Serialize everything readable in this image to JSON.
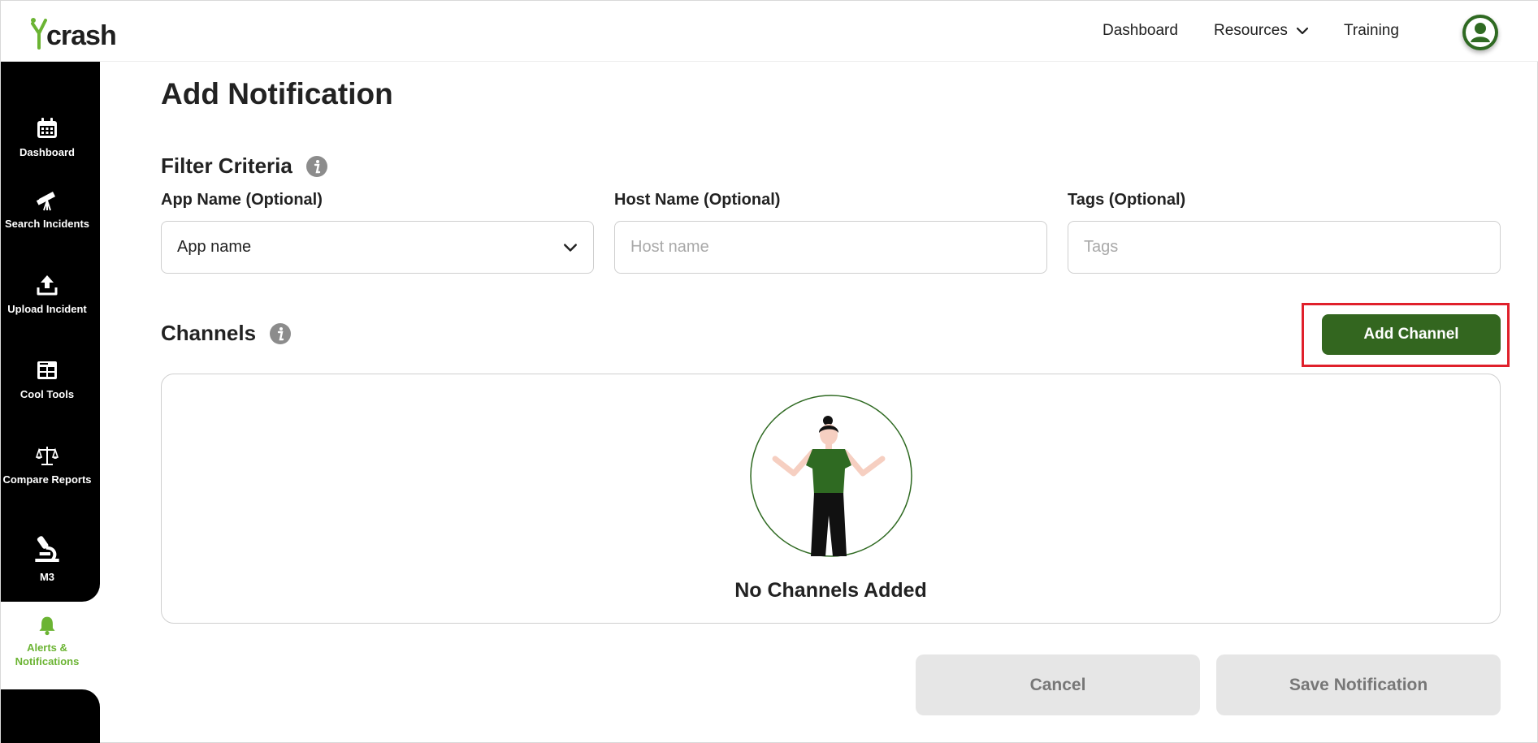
{
  "brand": {
    "name": "crash",
    "accent": "#33661f",
    "logo_green": "#6bb433"
  },
  "topnav": {
    "dashboard": "Dashboard",
    "resources": "Resources",
    "training": "Training",
    "avatar_icon": "user-circle-icon"
  },
  "sidebar": {
    "items": [
      {
        "label": "Dashboard",
        "icon": "calendar-icon"
      },
      {
        "label": "Search Incidents",
        "icon": "telescope-icon"
      },
      {
        "label": "Upload Incident",
        "icon": "upload-icon"
      },
      {
        "label": "Cool Tools",
        "icon": "grid-window-icon"
      },
      {
        "label": "Compare Reports",
        "icon": "scale-icon"
      },
      {
        "label": "M3",
        "icon": "microscope-icon"
      },
      {
        "label": "Alerts & Notifications",
        "icon": "bell-icon",
        "active": true
      }
    ]
  },
  "page": {
    "title": "Add Notification",
    "filter_title": "Filter Criteria",
    "app_name_label": "App Name (Optional)",
    "app_name_value": "App name",
    "host_name_label": "Host Name (Optional)",
    "host_name_placeholder": "Host name",
    "tags_label": "Tags (Optional)",
    "tags_placeholder": "Tags",
    "channels_title": "Channels",
    "add_channel": "Add Channel",
    "empty_state": "No Channels Added",
    "cancel": "Cancel",
    "save": "Save Notification"
  }
}
